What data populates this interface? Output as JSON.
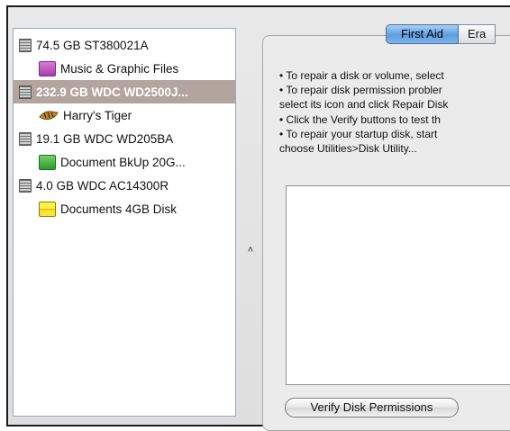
{
  "sidebar": {
    "items": [
      {
        "label": "74.5 GB ST380021A",
        "kind": "disk",
        "icon": "hard-drive-icon"
      },
      {
        "label": "Music & Graphic Files",
        "kind": "volume",
        "icon": "purple-volume-icon"
      },
      {
        "label": "232.9 GB WDC WD2500J...",
        "kind": "disk",
        "icon": "hard-drive-icon",
        "selected": true
      },
      {
        "label": "Harry's Tiger",
        "kind": "volume",
        "icon": "tiger-volume-icon"
      },
      {
        "label": "19.1 GB WDC WD205BA",
        "kind": "disk",
        "icon": "hard-drive-icon"
      },
      {
        "label": "Document BkUp 20G...",
        "kind": "volume",
        "icon": "green-volume-icon"
      },
      {
        "label": "4.0 GB WDC AC14300R",
        "kind": "disk",
        "icon": "hard-drive-icon"
      },
      {
        "label": "Documents 4GB Disk",
        "kind": "volume",
        "icon": "yellow-volume-icon"
      }
    ]
  },
  "splitter": {
    "glyph": "˄"
  },
  "tabs": [
    {
      "label": "First Aid",
      "active": true
    },
    {
      "label": "Era",
      "active": false
    }
  ],
  "instructions": [
    "• To repair a disk or volume, select",
    "• To repair disk permission probler",
    "select its icon and click Repair Disk",
    "• Click the Verify buttons to test th",
    "• To repair your startup disk, start",
    "choose Utilities>Disk Utility..."
  ],
  "buttons": {
    "verify_permissions": "Verify Disk Permissions"
  },
  "colors": {
    "selection": "#b4a49e",
    "tab_active": "#5c9de0"
  }
}
